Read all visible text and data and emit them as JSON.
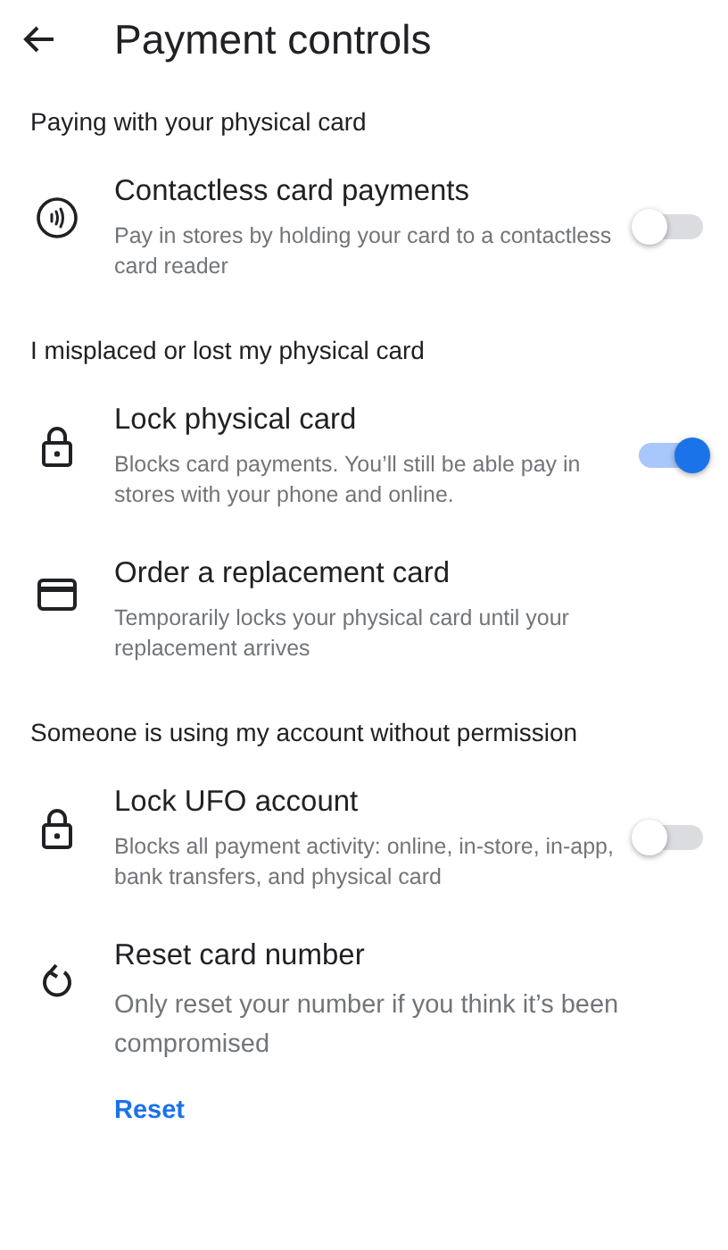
{
  "header": {
    "title": "Payment controls"
  },
  "sections": [
    {
      "heading": "Paying with your physical card",
      "items": [
        {
          "kind": "toggle",
          "title": "Contactless card payments",
          "description": "Pay in stores by holding your card to a contactless card reader",
          "on": false
        }
      ]
    },
    {
      "heading": "I misplaced or lost my physical card",
      "items": [
        {
          "kind": "toggle",
          "title": "Lock physical card",
          "description": "Blocks card payments. You’ll still be able pay in stores with your phone and online.",
          "on": true
        },
        {
          "kind": "plain",
          "title": "Order a replacement card",
          "description": "Temporarily locks your physical card until your replacement arrives"
        }
      ]
    },
    {
      "heading": "Someone is using my account without permission",
      "items": [
        {
          "kind": "toggle",
          "title": "Lock UFO account",
          "description": "Blocks all payment activity: online, in-store, in-app, bank transfers, and physical card",
          "on": false
        },
        {
          "kind": "action",
          "title": "Reset card number",
          "description": "Only reset your number if you think it’s been compromised",
          "action": "Reset"
        }
      ]
    }
  ]
}
